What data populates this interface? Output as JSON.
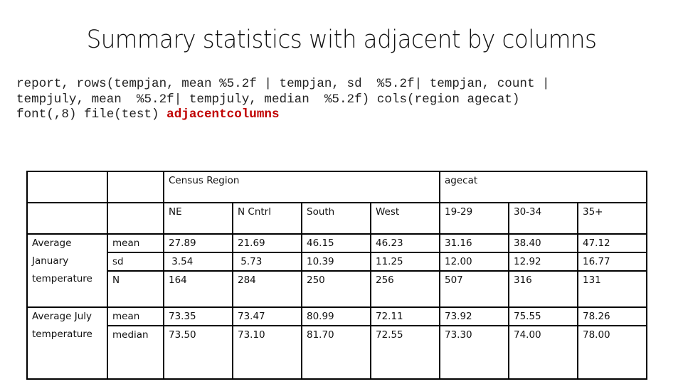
{
  "title": "Summary statistics with adjacent by columns",
  "code": {
    "line1": "report, rows(tempjan, mean %5.2f | tempjan, sd  %5.2f| tempjan, count |",
    "line2": "tempjuly, mean  %5.2f| tempjuly, median  %5.2f) cols(region agecat)",
    "line3_prefix": "font(,8) file(test) ",
    "line3_keyword": "adjacentcolumns"
  },
  "table": {
    "group_headers": [
      "Census Region",
      "agecat"
    ],
    "columns": [
      "NE",
      "N Cntrl",
      "South",
      "West",
      "19-29",
      "30-34",
      "35+"
    ],
    "row_groups": [
      {
        "label_lines": [
          "Average",
          "January",
          "temperature"
        ],
        "rows": [
          {
            "stat": "mean",
            "values": [
              "27.89",
              "21.69",
              "46.15",
              "46.23",
              "31.16",
              "38.40",
              "47.12"
            ]
          },
          {
            "stat": "sd",
            "values": [
              " 3.54",
              " 5.73",
              "10.39",
              "11.25",
              "12.00",
              "12.92",
              "16.77"
            ]
          },
          {
            "stat": "N",
            "values": [
              "164",
              "284",
              "250",
              "256",
              "507",
              "316",
              "131"
            ]
          }
        ]
      },
      {
        "label_lines": [
          "Average July",
          "temperature"
        ],
        "rows": [
          {
            "stat": "mean",
            "values": [
              "73.35",
              "73.47",
              "80.99",
              "72.11",
              "73.92",
              "75.55",
              "78.26"
            ]
          },
          {
            "stat": "median",
            "values": [
              "73.50",
              "73.10",
              "81.70",
              "72.55",
              "73.30",
              "74.00",
              "78.00"
            ]
          }
        ]
      }
    ]
  }
}
